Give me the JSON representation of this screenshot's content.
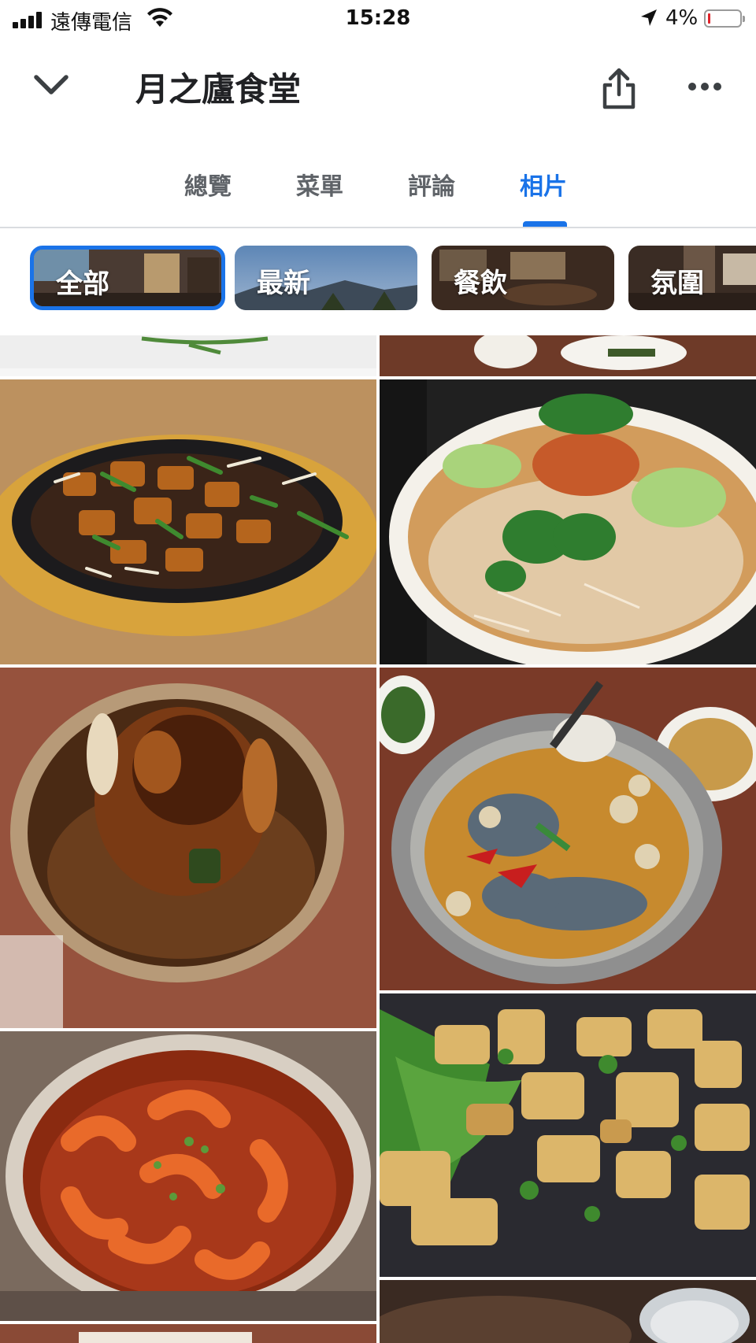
{
  "status_bar": {
    "carrier": "遠傳電信",
    "time": "15:28",
    "battery_percent": "4%",
    "battery_level": 0.04,
    "icons": [
      "signal-icon",
      "wifi-icon",
      "location-arrow-icon",
      "battery-icon"
    ]
  },
  "header": {
    "title": "月之廬食堂",
    "icons": [
      "chevron-down-icon",
      "share-icon",
      "more-icon"
    ]
  },
  "tabs": [
    {
      "label": "總覽"
    },
    {
      "label": "菜單"
    },
    {
      "label": "評論"
    },
    {
      "label": "相片",
      "active": true
    }
  ],
  "chips": [
    {
      "label": "全部",
      "selected": true
    },
    {
      "label": "最新"
    },
    {
      "label": "餐飲"
    },
    {
      "label": "氛圍"
    }
  ],
  "photos": [
    {
      "subject": "tofu stir-fry on sizzling plate"
    },
    {
      "subject": "noodle soup with cilantro and scallions"
    },
    {
      "subject": "roast chicken in clay pot"
    },
    {
      "subject": "seafood hot pot with shrimp"
    },
    {
      "subject": "drunken shrimp in clay pot"
    },
    {
      "subject": "fried tofu with greens"
    }
  ],
  "colors": {
    "accent": "#1a73e8",
    "tab_inactive": "#5f6368",
    "battery_low": "#e0242b"
  }
}
